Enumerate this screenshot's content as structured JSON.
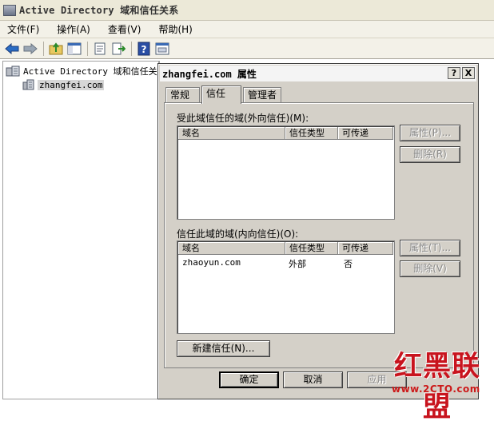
{
  "window": {
    "title": "Active Directory 域和信任关系"
  },
  "menu": [
    {
      "label": "文件(F)"
    },
    {
      "label": "操作(A)"
    },
    {
      "label": "查看(V)"
    },
    {
      "label": "帮助(H)"
    }
  ],
  "toolbar": {
    "icons": [
      "back-icon",
      "forward-icon",
      "up-folder-icon",
      "console-tree-icon",
      "properties-icon",
      "export-list-icon",
      "help-icon",
      "mmc-icon"
    ]
  },
  "tree": {
    "root": "Active Directory 域和信任关系",
    "child": "zhangfei.com"
  },
  "dialog": {
    "title": "zhangfei.com 属性",
    "help_btn": "?",
    "close_btn": "X",
    "tabs": [
      "常规",
      "信任",
      "管理者"
    ],
    "active_tab": "信任",
    "outgoing": {
      "label": "受此域信任的域(外向信任)(M):",
      "columns": [
        "域名",
        "信任类型",
        "可传递"
      ],
      "rows": [],
      "properties_btn": "属性(P)...",
      "remove_btn": "删除(R)"
    },
    "incoming": {
      "label": "信任此域的域(内向信任)(O):",
      "columns": [
        "域名",
        "信任类型",
        "可传递"
      ],
      "rows": [
        {
          "domain": "zhaoyun.com",
          "type": "外部",
          "transitive": "否"
        }
      ],
      "properties_btn": "属性(T)...",
      "remove_btn": "删除(V)"
    },
    "new_trust_btn": "新建信任(N)...",
    "ok_btn": "确定",
    "cancel_btn": "取消",
    "apply_btn": "应用"
  },
  "watermark": {
    "text": "红黑联盟",
    "url": "www.2CTO.com"
  },
  "colors": {
    "watermark": "#c8141e",
    "dialog_face": "#d4d0c8"
  }
}
